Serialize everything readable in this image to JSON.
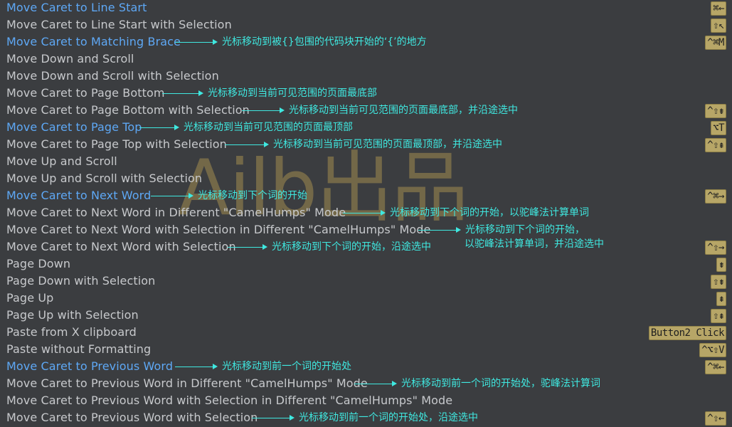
{
  "watermark": "Ailb出品",
  "rows": [
    {
      "action": "Move Caret to Line Start",
      "highlight": true,
      "shortcut": "⌘←"
    },
    {
      "action": "Move Caret to Line Start with Selection",
      "highlight": false,
      "shortcut": "⇧↖"
    },
    {
      "action": "Move Caret to Matching Brace",
      "highlight": true,
      "note": "光标移动到被{}包围的代码块开始的‘{’的地方",
      "shortcut": "^⌘M"
    },
    {
      "action": "Move Down and Scroll",
      "highlight": false
    },
    {
      "action": "Move Down and Scroll with Selection",
      "highlight": false
    },
    {
      "action": "Move Caret to Page Bottom",
      "highlight": false,
      "note": "光标移动到当前可见范围的页面最底部"
    },
    {
      "action": "Move Caret to Page Bottom with Selection",
      "highlight": false,
      "note": "光标移动到当前可见范围的页面最底部，并沿途选中",
      "shortcut": "^⇧⇟"
    },
    {
      "action": "Move Caret to Page Top",
      "highlight": true,
      "note": "光标移动到当前可见范围的页面最顶部",
      "shortcut": "⌥T"
    },
    {
      "action": "Move Caret to Page Top with Selection",
      "highlight": false,
      "note": "光标移动到当前可见范围的页面最顶部，并沿途选中",
      "shortcut": "^⇧⇞"
    },
    {
      "action": "Move Up and Scroll",
      "highlight": false
    },
    {
      "action": "Move Up and Scroll with Selection",
      "highlight": false
    },
    {
      "action": "Move Caret to Next Word",
      "highlight": true,
      "note": "光标移动到下个词的开始",
      "shortcut": "^⌘→"
    },
    {
      "action": "Move Caret to Next Word in Different \"CamelHumps\" Mode",
      "highlight": false,
      "note": "光标移动到下个词的开始，以驼峰法计算单词"
    },
    {
      "action": "Move Caret to Next Word with Selection in Different \"CamelHumps\" Mode",
      "highlight": false,
      "note": "光标移动到下个词的开始，",
      "note2": "以驼峰法计算单词，并沿途选中"
    },
    {
      "action": "Move Caret to Next Word with Selection",
      "highlight": false,
      "note": "光标移动到下个词的开始，沿途选中",
      "shortcut": "^⇧→"
    },
    {
      "action": "Page Down",
      "highlight": false,
      "shortcut": "⇟"
    },
    {
      "action": "Page Down with Selection",
      "highlight": false,
      "shortcut": "⇧⇟"
    },
    {
      "action": "Page Up",
      "highlight": false,
      "shortcut": "⇞"
    },
    {
      "action": "Page Up with Selection",
      "highlight": false,
      "shortcut": "⇧⇞"
    },
    {
      "action": "Paste from X clipboard",
      "highlight": false,
      "shortcut": "Button2 Click"
    },
    {
      "action": "Paste without Formatting",
      "highlight": false,
      "shortcut": "^⌥⇧V"
    },
    {
      "action": "Move Caret to Previous Word",
      "highlight": true,
      "note": "光标移动到前一个词的开始处",
      "shortcut": "^⌘←"
    },
    {
      "action": "Move Caret to Previous Word in Different \"CamelHumps\" Mode",
      "highlight": false,
      "note": "光标移动到前一个词的开始处，驼峰法计算词"
    },
    {
      "action": "Move Caret to Previous Word with Selection in Different \"CamelHumps\" Mode",
      "highlight": false
    },
    {
      "action": "Move Caret to Previous Word with Selection",
      "highlight": false,
      "note": "光标移动到前一个词的开始处，沿途选中",
      "shortcut": "^⇧←"
    }
  ]
}
